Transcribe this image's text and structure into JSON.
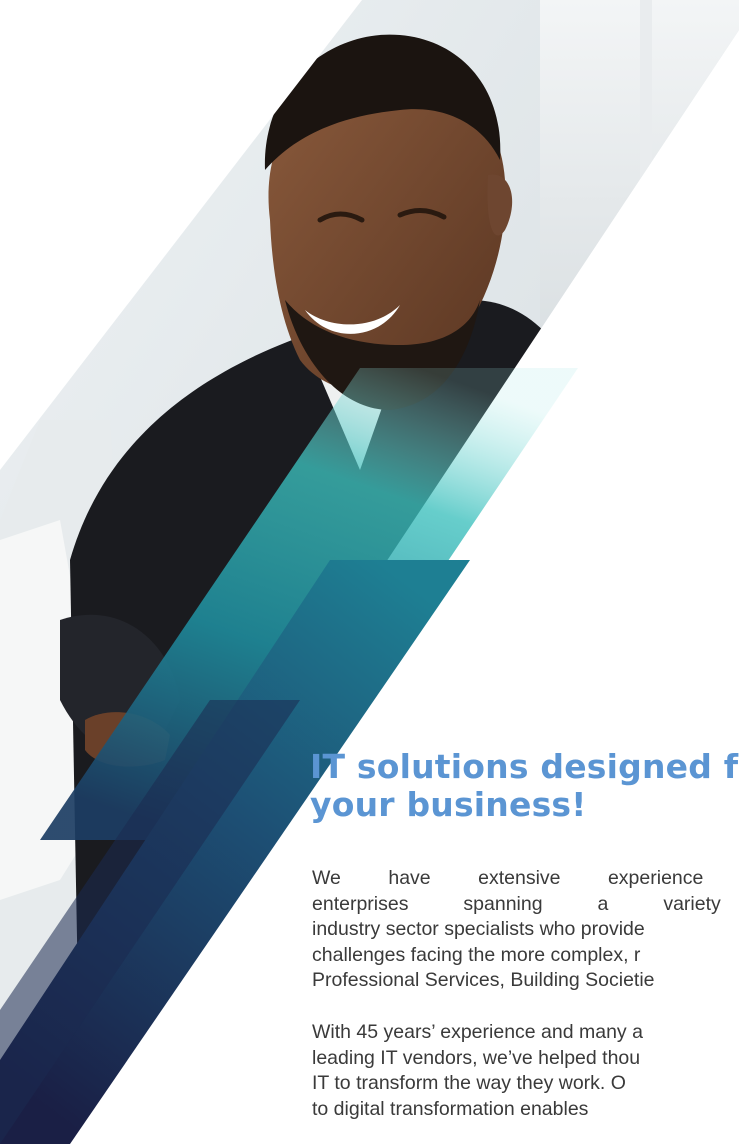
{
  "headline": {
    "line1": "IT solutions designed f",
    "line2": "your business!"
  },
  "paragraph1": {
    "lines": [
      "We have extensive experience work",
      "enterprises spanning a variety of",
      "industry sector specialists who provide",
      "challenges facing the more complex, r",
      "Professional Services, Building Societie"
    ]
  },
  "paragraph2": {
    "lines": [
      "With 45 years’ experience and many a",
      "leading IT vendors, we’ve helped thou",
      "IT to transform the way they work. O",
      "to digital transformation enables"
    ]
  },
  "colors": {
    "headline": "#5b95d3",
    "body": "#3a3a3a",
    "teal": "#2eb8b8",
    "navy": "#1c2a4a"
  }
}
